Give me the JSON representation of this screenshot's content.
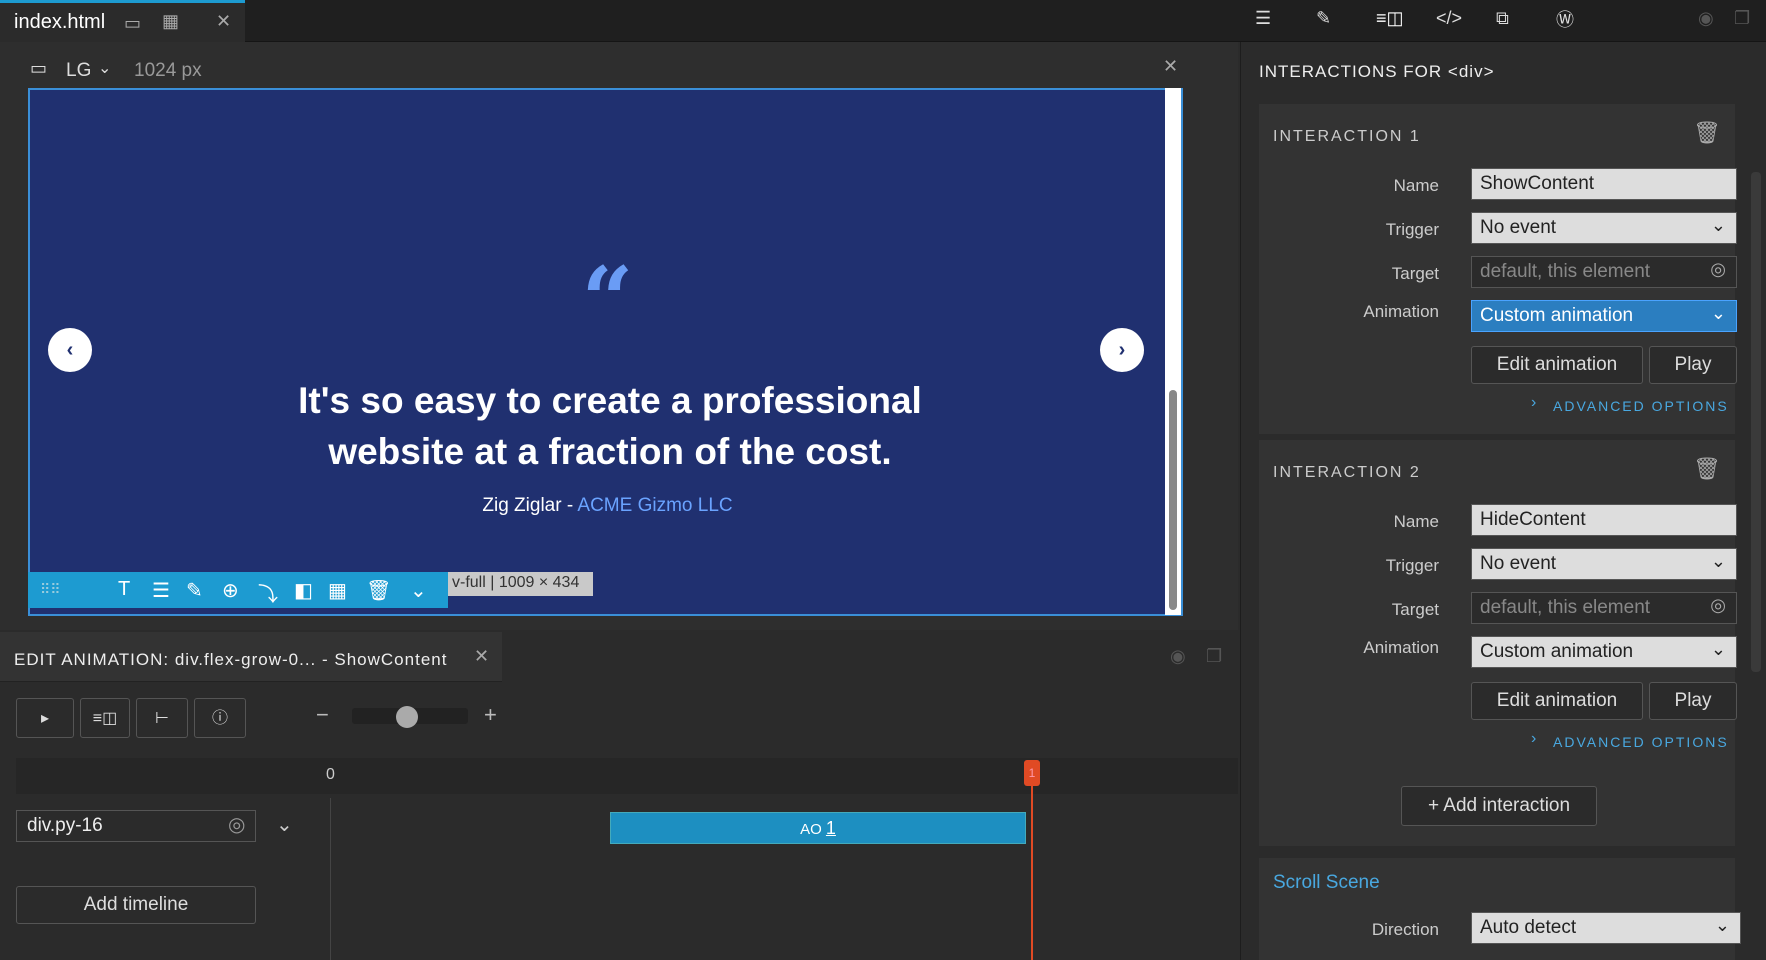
{
  "tab": {
    "filename": "index.html"
  },
  "viewport": {
    "label": "LG",
    "width": "1024 px"
  },
  "canvas": {
    "headline": "It's so easy to create a professional website at a fraction of the cost.",
    "author": "Zig Ziglar -",
    "company": "ACME Gizmo LLC",
    "size_tag": "v-full | 1009 × 434"
  },
  "animation": {
    "title": "EDIT ANIMATION: div.flex-grow-0... - ShowContent",
    "timeline_start": "0",
    "track_label": "div.py-16",
    "clip_label": "AO",
    "clip_value": "1",
    "marker": "1",
    "add_timeline": "Add timeline"
  },
  "panel": {
    "title": "INTERACTIONS FOR",
    "title_tag": "<div>",
    "interactions": [
      {
        "heading": "INTERACTION 1",
        "name_label": "Name",
        "name": "ShowContent",
        "trigger_label": "Trigger",
        "trigger": "No event",
        "target_label": "Target",
        "target": "default, this element",
        "animation_label": "Animation",
        "animation": "Custom animation",
        "edit": "Edit animation",
        "play": "Play",
        "advanced": "ADVANCED OPTIONS"
      },
      {
        "heading": "INTERACTION 2",
        "name_label": "Name",
        "name": "HideContent",
        "trigger_label": "Trigger",
        "trigger": "No event",
        "target_label": "Target",
        "target": "default, this element",
        "animation_label": "Animation",
        "animation": "Custom animation",
        "edit": "Edit animation",
        "play": "Play",
        "advanced": "ADVANCED OPTIONS"
      }
    ],
    "add_interaction": "Add interaction",
    "scroll_scene": "Scroll Scene",
    "direction_label": "Direction",
    "direction": "Auto detect"
  }
}
